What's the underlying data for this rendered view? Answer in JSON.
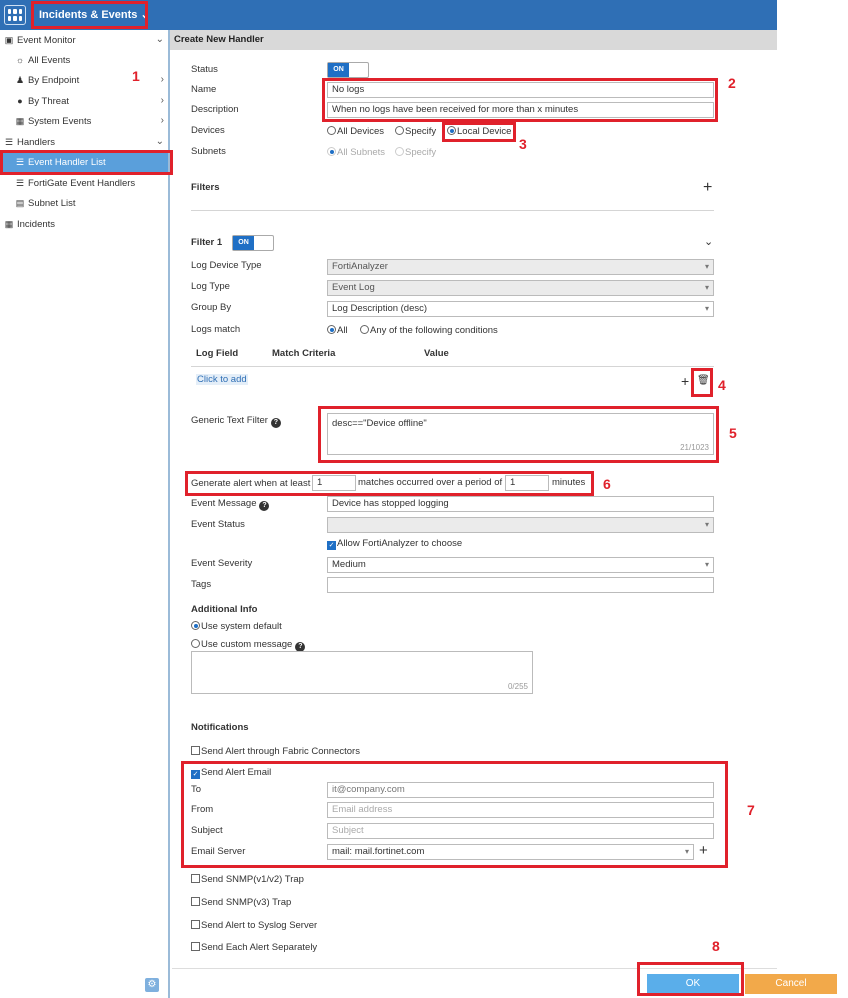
{
  "topbar": {
    "menu_label": "Incidents & Events"
  },
  "sidebar": {
    "items": [
      {
        "label": "Event Monitor",
        "icon": "monitor-icon"
      },
      {
        "label": "All Events",
        "icon": "globe-icon"
      },
      {
        "label": "By Endpoint",
        "icon": "users-icon"
      },
      {
        "label": "By Threat",
        "icon": "bomb-icon"
      },
      {
        "label": "System Events",
        "icon": "system-icon"
      },
      {
        "label": "Handlers",
        "icon": "list-icon"
      },
      {
        "label": "Event Handler List",
        "icon": "list-icon"
      },
      {
        "label": "FortiGate Event Handlers",
        "icon": "list-icon"
      },
      {
        "label": "Subnet List",
        "icon": "subnet-icon"
      },
      {
        "label": "Incidents",
        "icon": "table-icon"
      }
    ]
  },
  "page": {
    "title": "Create New Handler"
  },
  "form": {
    "status_label": "Status",
    "status_toggle": "ON",
    "name_label": "Name",
    "name_value": "No logs",
    "description_label": "Description",
    "description_value": "When no logs have been received for more than x minutes",
    "devices_label": "Devices",
    "devices_options": [
      "All Devices",
      "Specify",
      "Local Device"
    ],
    "subnets_label": "Subnets",
    "subnets_options": [
      "All Subnets",
      "Specify"
    ],
    "filters_heading": "Filters",
    "filter1_label": "Filter 1",
    "filter1_toggle": "ON",
    "log_device_type_label": "Log Device Type",
    "log_device_type_value": "FortiAnalyzer",
    "log_type_label": "Log Type",
    "log_type_value": "Event Log",
    "group_by_label": "Group By",
    "group_by_value": "Log Description (desc)",
    "logs_match_label": "Logs match",
    "logs_match_options": [
      "All",
      "Any of the following conditions"
    ],
    "table_headers": [
      "Log Field",
      "Match Criteria",
      "Value"
    ],
    "click_to_add": "Click to add",
    "generic_text_filter_label": "Generic Text Filter",
    "generic_text_filter_value": "desc==\"Device offline\"",
    "generic_text_filter_counter": "21/1023",
    "alert_prefix": "Generate alert when at least",
    "alert_matches": "1",
    "alert_middle": "matches occurred over a period of",
    "alert_period": "1",
    "alert_suffix": "minutes",
    "event_message_label": "Event Message",
    "event_message_value": "Device has stopped logging",
    "event_status_label": "Event Status",
    "allow_choose_label": "Allow FortiAnalyzer to choose",
    "event_severity_label": "Event Severity",
    "event_severity_value": "Medium",
    "tags_label": "Tags",
    "additional_info_heading": "Additional Info",
    "use_system_default": "Use system default",
    "use_custom_message": "Use custom message",
    "custom_message_counter": "0/255",
    "notifications_heading": "Notifications",
    "send_fabric": "Send Alert through Fabric Connectors",
    "send_email": "Send Alert Email",
    "to_label": "To",
    "to_value": "it@company.com",
    "from_label": "From",
    "from_placeholder": "Email address",
    "subject_label": "Subject",
    "subject_placeholder": "Subject",
    "email_server_label": "Email Server",
    "email_server_value": "mail: mail.fortinet.com",
    "send_snmp_v1": "Send SNMP(v1/v2) Trap",
    "send_snmp_v3": "Send SNMP(v3) Trap",
    "send_syslog": "Send Alert to Syslog Server",
    "send_each": "Send Each Alert Separately"
  },
  "buttons": {
    "ok": "OK",
    "cancel": "Cancel"
  },
  "annotations": [
    "1",
    "2",
    "3",
    "4",
    "5",
    "6",
    "7",
    "8"
  ],
  "colors": {
    "topbar": "#2f6fb5",
    "accent": "#1f6fc5",
    "highlight": "#e0212b",
    "ok": "#5aaeea",
    "cancel": "#f2a94a"
  }
}
